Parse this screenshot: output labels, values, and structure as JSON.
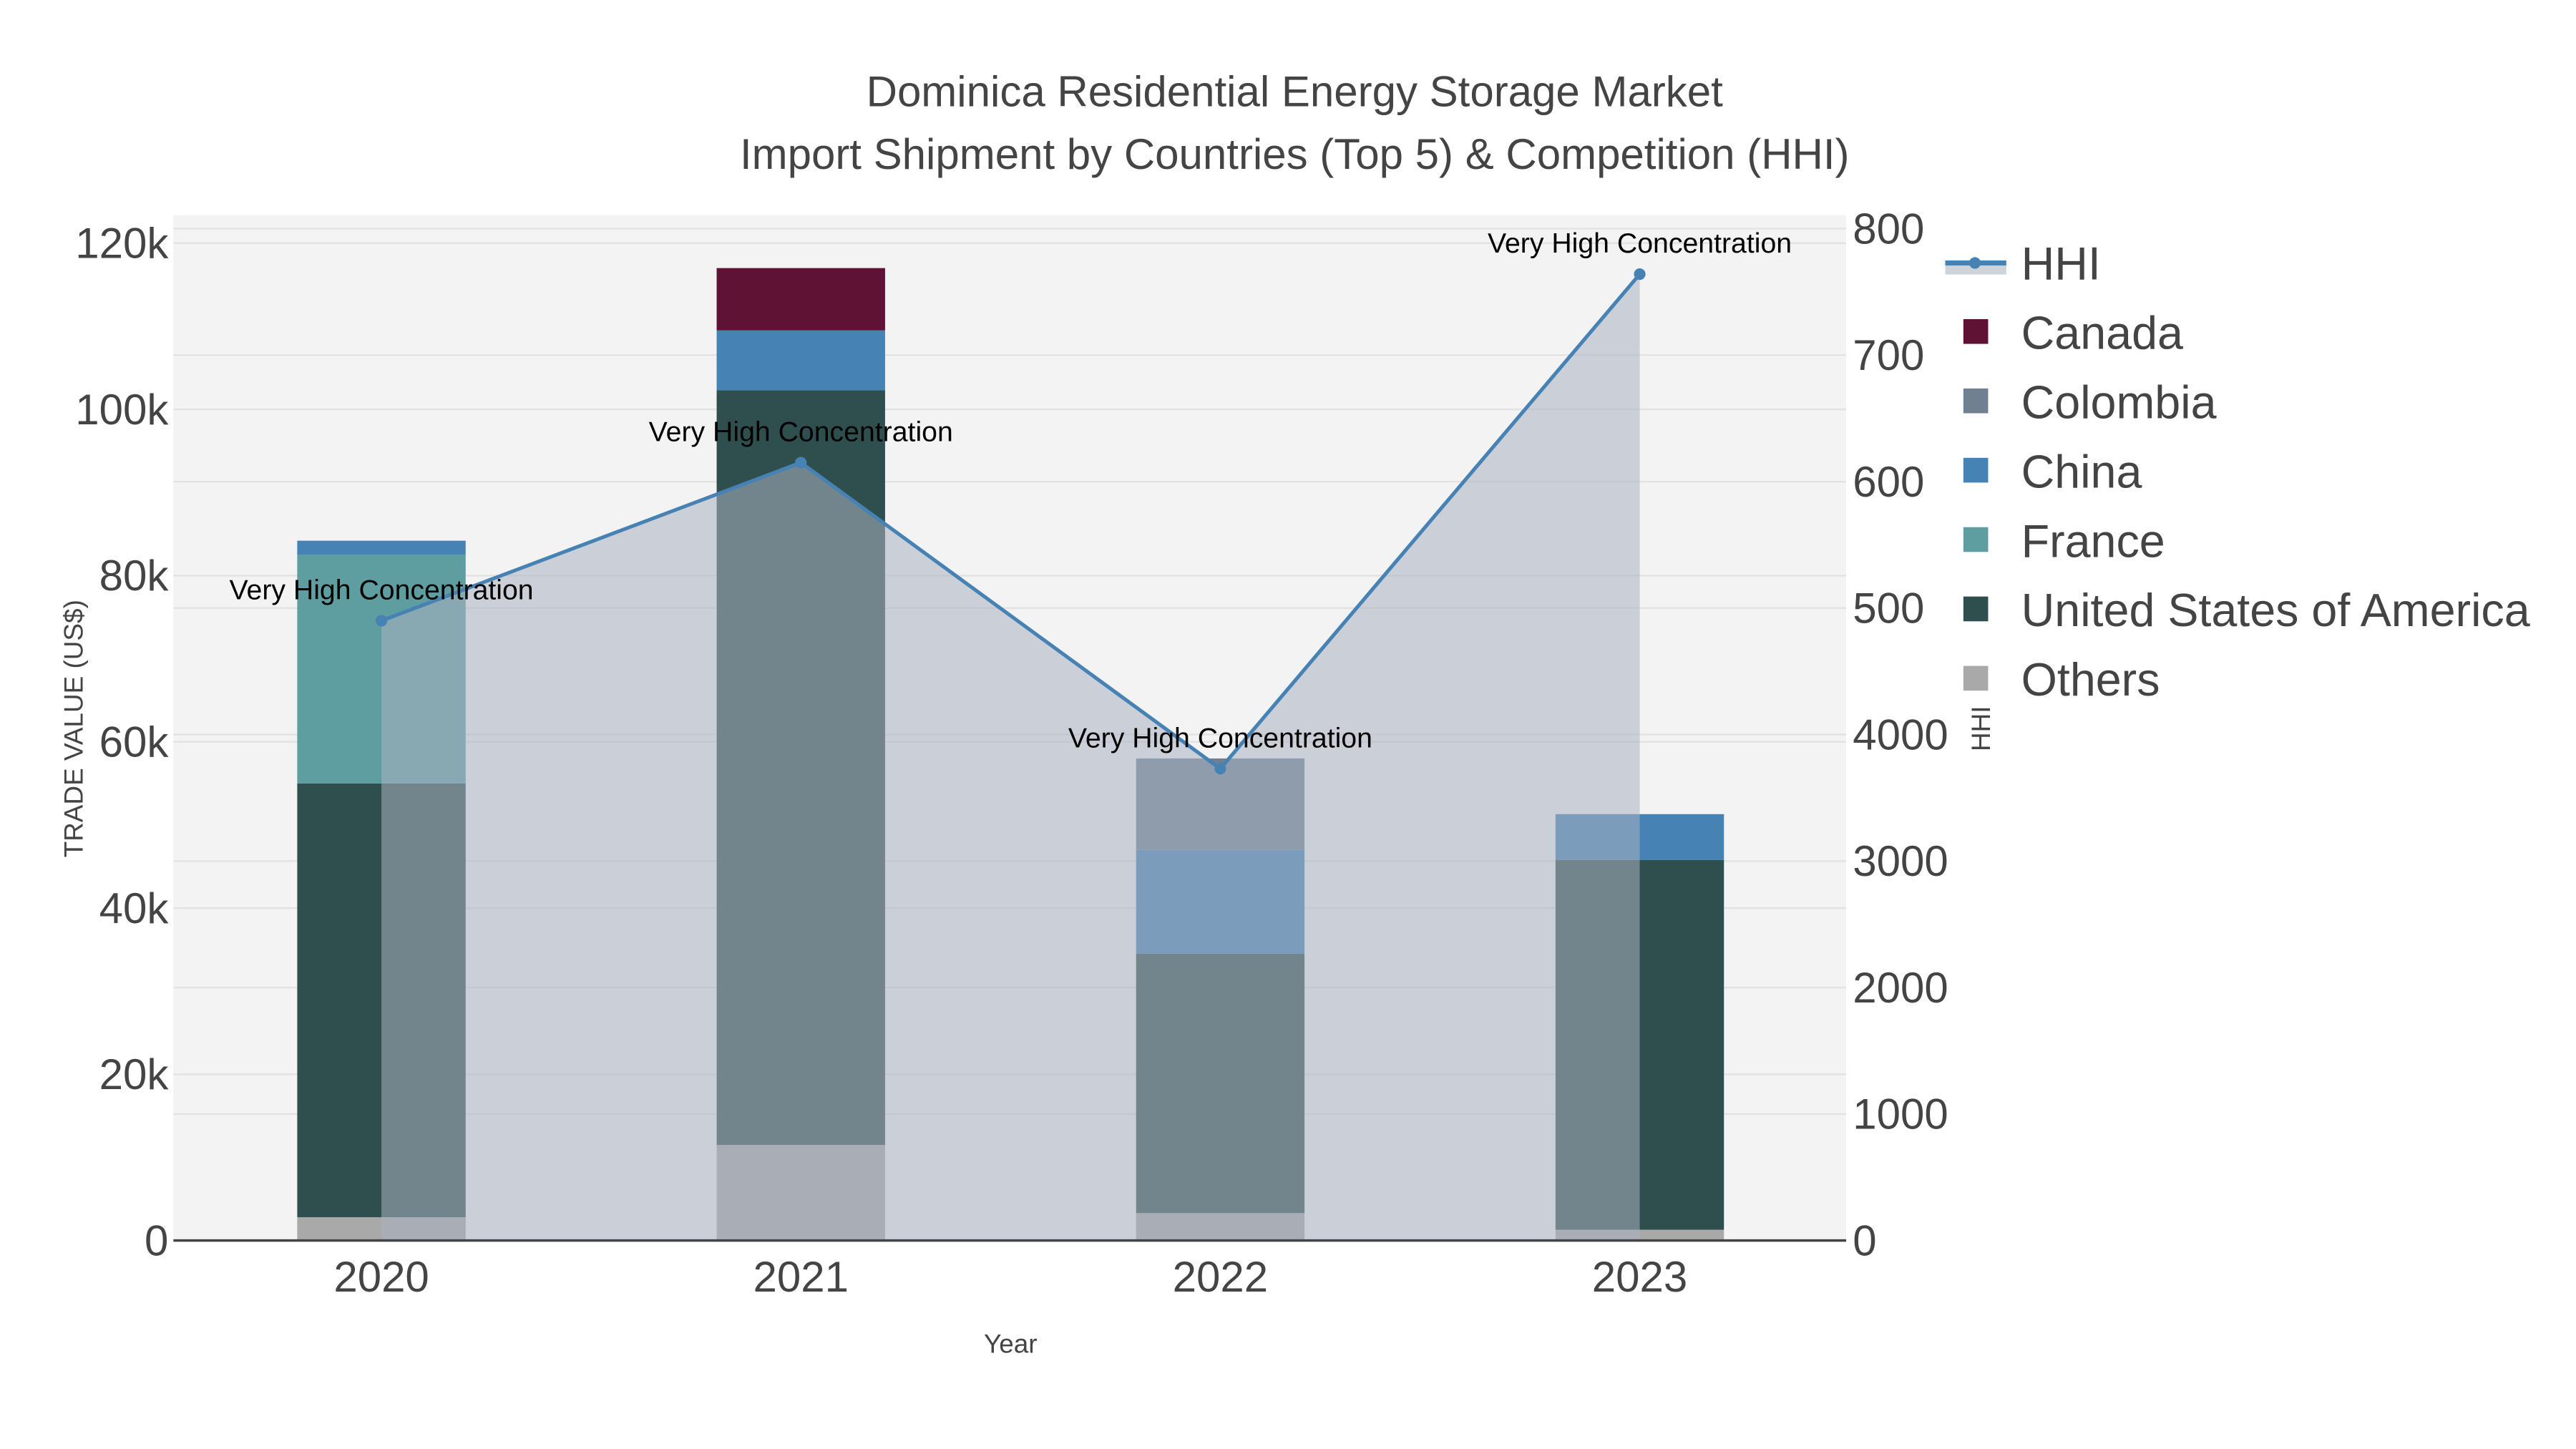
{
  "chart_data": {
    "type": "bar",
    "title": "Dominica Residential Energy Storage Market",
    "subtitle": "Import Shipment by Countries (Top 5) & Competition (HHI)",
    "xlabel": "Year",
    "ylabel": "TRADE VALUE (US$)",
    "y2label": "HHI",
    "categories": [
      "2020",
      "2021",
      "2022",
      "2023"
    ],
    "ylim": [
      0,
      123000
    ],
    "y2lim": [
      0,
      8100
    ],
    "yticks": [
      0,
      20000,
      40000,
      60000,
      80000,
      100000,
      120000
    ],
    "ytick_labels": [
      "0",
      "20k",
      "40k",
      "60k",
      "80k",
      "100k",
      "120k"
    ],
    "y2ticks": [
      0,
      1000,
      2000,
      3000,
      4000,
      5000,
      6000,
      7000,
      8000
    ],
    "y2tick_labels": [
      "0",
      "1000",
      "2000",
      "3000",
      "4000",
      "500",
      "600",
      "700",
      "800"
    ],
    "stacked": true,
    "grid": true,
    "legend_position": "right",
    "series": [
      {
        "name": "Others",
        "color": "#a9a9a9",
        "values": [
          2800,
          11500,
          3300,
          1300
        ]
      },
      {
        "name": "United States of America",
        "color": "#2f4f4f",
        "values": [
          52200,
          90800,
          31200,
          44500
        ]
      },
      {
        "name": "France",
        "color": "#5f9ea0",
        "values": [
          27500,
          0,
          0,
          0
        ]
      },
      {
        "name": "China",
        "color": "#4682b4",
        "values": [
          1700,
          7200,
          12500,
          5500
        ]
      },
      {
        "name": "Colombia",
        "color": "#708090",
        "values": [
          0,
          0,
          11000,
          0
        ]
      },
      {
        "name": "Canada",
        "color": "#601235",
        "values": [
          0,
          7500,
          0,
          0
        ]
      }
    ],
    "line": {
      "name": "HHI",
      "color": "#4682b4",
      "axis": "right",
      "values": [
        4900,
        6150,
        3730,
        7640
      ],
      "annotations": [
        "Very High Concentration",
        "Very High Concentration",
        "Very High Concentration",
        "Very High Concentration"
      ]
    },
    "legend_order": [
      "HHI",
      "Canada",
      "Colombia",
      "China",
      "France",
      "United States of America",
      "Others"
    ]
  }
}
